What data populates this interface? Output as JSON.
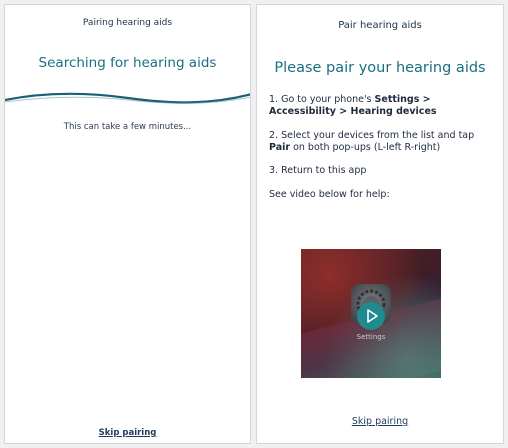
{
  "left_screen": {
    "nav_title": "Pairing hearing aids",
    "heading": "Searching for hearing aids",
    "subtext": "This can take a few minutes...",
    "skip_label": "Skip pairing"
  },
  "right_screen": {
    "nav_title": "Pair hearing aids",
    "heading": "Please pair your hearing aids",
    "steps": {
      "s1_prefix": "1. Go to your phone's ",
      "s1_bold": "Settings > Accessibility > Hearing devices",
      "s2_prefix": "2. Select your devices from the list and tap ",
      "s2_bold": "Pair",
      "s2_suffix": " on both pop-ups (L-left R-right)",
      "s3": "3. Return to this app",
      "help": "See video below for help:"
    },
    "video": {
      "app_label": "Settings",
      "play_icon": "play-icon",
      "app_icon": "settings-gear-icon"
    },
    "skip_label": "Skip pairing"
  },
  "colors": {
    "heading": "#1a6f83",
    "nav_title": "#1f2f4a",
    "wave": "#1a5f73",
    "play_button": "#1f8b8e"
  }
}
